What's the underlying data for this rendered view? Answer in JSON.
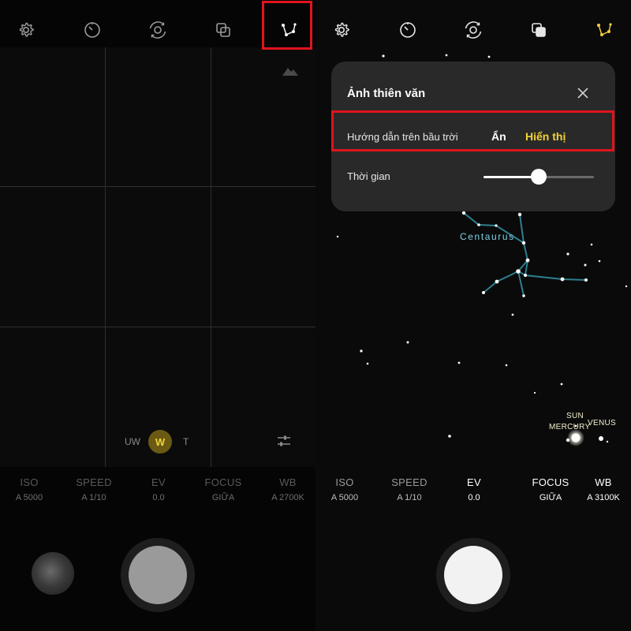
{
  "accent_color": "#f4d238",
  "highlight_color": "#e0141d",
  "left_screen": {
    "toolbar_icons": [
      "gear-icon",
      "timer-icon",
      "aperture-icon",
      "filter-icon",
      "astro-constellation-icon"
    ],
    "zoom": {
      "uw": "UW",
      "w": "W",
      "t": "T"
    },
    "params": [
      {
        "label": "ISO",
        "value": "A 5000"
      },
      {
        "label": "SPEED",
        "value": "A 1/10"
      },
      {
        "label": "EV",
        "value": "0.0"
      },
      {
        "label": "FOCUS",
        "value": "GIỮA"
      },
      {
        "label": "WB",
        "value": "A 2700K"
      }
    ]
  },
  "right_screen": {
    "toolbar_icons": [
      "gear-icon",
      "timer-icon",
      "aperture-icon",
      "filter-icon",
      "astro-constellation-icon"
    ],
    "popup": {
      "title": "Ảnh thiên văn",
      "guide_label": "Hướng dẫn trên bầu trời",
      "option_hide": "Ẩn",
      "option_show": "Hiển thị",
      "selected_option": "Hiển thị",
      "time_label": "Thời gian",
      "time_slider_level": 0.5
    },
    "sky_labels": {
      "constellation": "Centaurus",
      "sun": "SUN",
      "mercury": "MERCURY",
      "venus": "VENUS"
    },
    "params": [
      {
        "label": "ISO",
        "value": "A 5000"
      },
      {
        "label": "SPEED",
        "value": "A 1/10"
      },
      {
        "label": "EV",
        "value": "0.0"
      },
      {
        "label": "FOCUS",
        "value": "GIỮA"
      },
      {
        "label": "WB",
        "value": "A 3100K"
      }
    ]
  }
}
